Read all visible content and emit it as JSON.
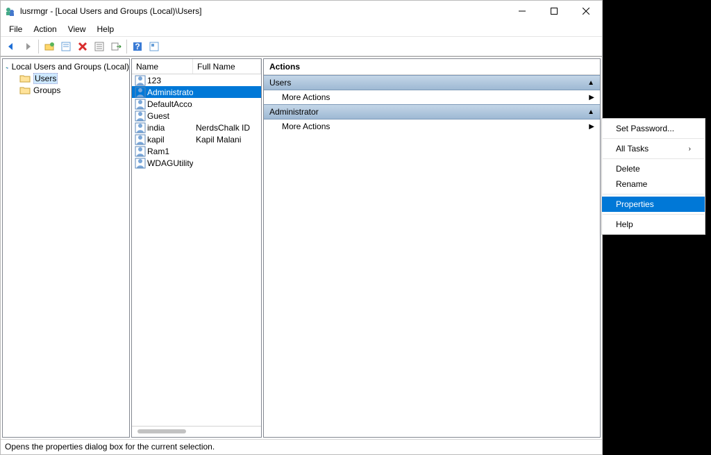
{
  "title": "lusrmgr - [Local Users and Groups (Local)\\Users]",
  "menu": {
    "file": "File",
    "action": "Action",
    "view": "View",
    "help": "Help"
  },
  "tree": {
    "root": "Local Users and Groups (Local)",
    "users": "Users",
    "groups": "Groups"
  },
  "list": {
    "col_name": "Name",
    "col_full": "Full Name",
    "rows": [
      {
        "name": "123",
        "full": ""
      },
      {
        "name": "Administrator",
        "full": ""
      },
      {
        "name": "DefaultAcco...",
        "full": ""
      },
      {
        "name": "Guest",
        "full": ""
      },
      {
        "name": "india",
        "full": "NerdsChalk ID"
      },
      {
        "name": "kapil",
        "full": "Kapil Malani"
      },
      {
        "name": "Ram1",
        "full": ""
      },
      {
        "name": "WDAGUtility...",
        "full": ""
      }
    ]
  },
  "actions": {
    "title": "Actions",
    "section1": "Users",
    "more": "More Actions",
    "section2": "Administrator"
  },
  "context_menu": {
    "set_password": "Set Password...",
    "all_tasks": "All Tasks",
    "delete": "Delete",
    "rename": "Rename",
    "properties": "Properties",
    "help": "Help"
  },
  "status": "Opens the properties dialog box for the current selection."
}
